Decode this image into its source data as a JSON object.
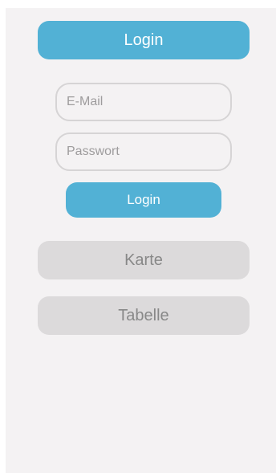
{
  "tabs": {
    "login_label": "Login",
    "map_label": "Karte",
    "table_label": "Tabelle"
  },
  "form": {
    "email_placeholder": "E-Mail",
    "email_value": "",
    "password_placeholder": "Passwort",
    "password_value": "",
    "submit_label": "Login"
  },
  "colors": {
    "accent": "#52b1d5",
    "background": "#f4f2f3",
    "inactive_button": "#dcdadb",
    "inactive_text": "#888888",
    "field_border": "#d6d4d5"
  }
}
